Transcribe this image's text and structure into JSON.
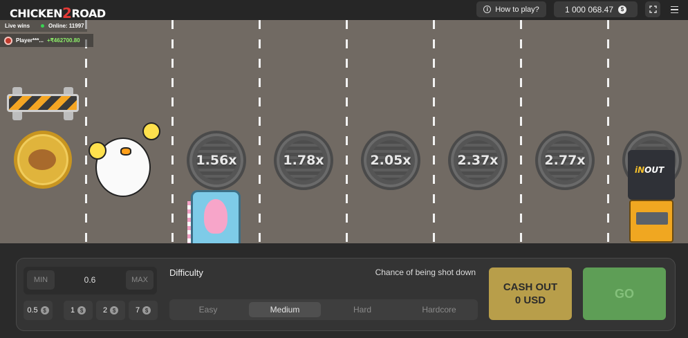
{
  "header": {
    "logo": {
      "left": "CHICKEN",
      "mid": "2",
      "right": "ROAD"
    },
    "how_to_play": "How to play?",
    "balance": "1 000 068.47",
    "currency_icon": "dollar-coin-icon"
  },
  "live": {
    "title": "Live wins",
    "online": "Online: 11997",
    "win": {
      "player": "Player***...",
      "amount": "+₹462700.80"
    }
  },
  "multipliers": [
    "1.56x",
    "1.78x",
    "2.05x",
    "2.37x",
    "2.77x"
  ],
  "truck_brand": {
    "a": "iN",
    "b": "OUT"
  },
  "bet": {
    "min_label": "MIN",
    "value": "0.6",
    "max_label": "MAX",
    "chips": [
      "0.5",
      "1",
      "2",
      "7"
    ]
  },
  "difficulty": {
    "label": "Difficulty",
    "chance_label": "Chance of being shot down",
    "options": [
      "Easy",
      "Medium",
      "Hard",
      "Hardcore"
    ],
    "selected": "Medium"
  },
  "cashout": {
    "line1": "CASH OUT",
    "line2": "0 USD"
  },
  "go": "GO",
  "colors": {
    "road": "#716a63",
    "cashout": "#b89e4a",
    "go": "#5e9e56",
    "online_dot": "#39d353",
    "win_amount": "#8ef06a"
  }
}
